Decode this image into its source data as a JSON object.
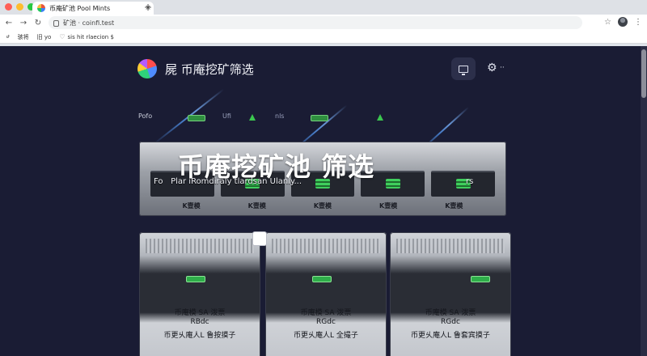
{
  "browser": {
    "tab_title": "币庵矿池 Pool Mints",
    "new_tab": "+",
    "tab_close": "×",
    "url": "矿池 · coinfi.test",
    "bookmarks": [
      {
        "icon": "bookmark-icon",
        "label": "ሀ"
      },
      {
        "icon": "folder-icon",
        "label": "骇将"
      },
      {
        "icon": "folder-icon",
        "label": "旧 yo"
      },
      {
        "icon": "heart-icon",
        "label": "sis hit rlaecion $"
      }
    ]
  },
  "app": {
    "title": "屍 币庵挖矿筛选",
    "settings_dots": "··"
  },
  "filters": {
    "label": "Pofo",
    "chips": [
      "Ufi",
      "nls"
    ]
  },
  "hero": {
    "title": "币庵挖矿池 筛选",
    "subtitle_prefix": "Fo",
    "subtitle": "Plar   iRomdiraly  tlardsan  Ulanly...",
    "subtitle_end": "rs",
    "bay_labels": [
      "K壹模",
      "K壹模",
      "K壹模",
      "K壹模",
      "K壹模"
    ]
  },
  "cards": [
    {
      "title": "币庵模 SA 泼票",
      "code": "RBdc",
      "desc": "币更乆庵人L 鲁按摸子"
    },
    {
      "title": "币庵模 SA 泼票",
      "code": "RGdc",
      "desc": "币更乆庵人L 全撮子"
    },
    {
      "title": "币庵模 SA 泼票",
      "code": "RGdc",
      "desc": "币更乆庵人L 鲁套宾摸子"
    }
  ],
  "colors": {
    "page_bg": "#1a1c34",
    "accent_green": "#3bc64f",
    "trace_blue": "#4f8fe6"
  }
}
